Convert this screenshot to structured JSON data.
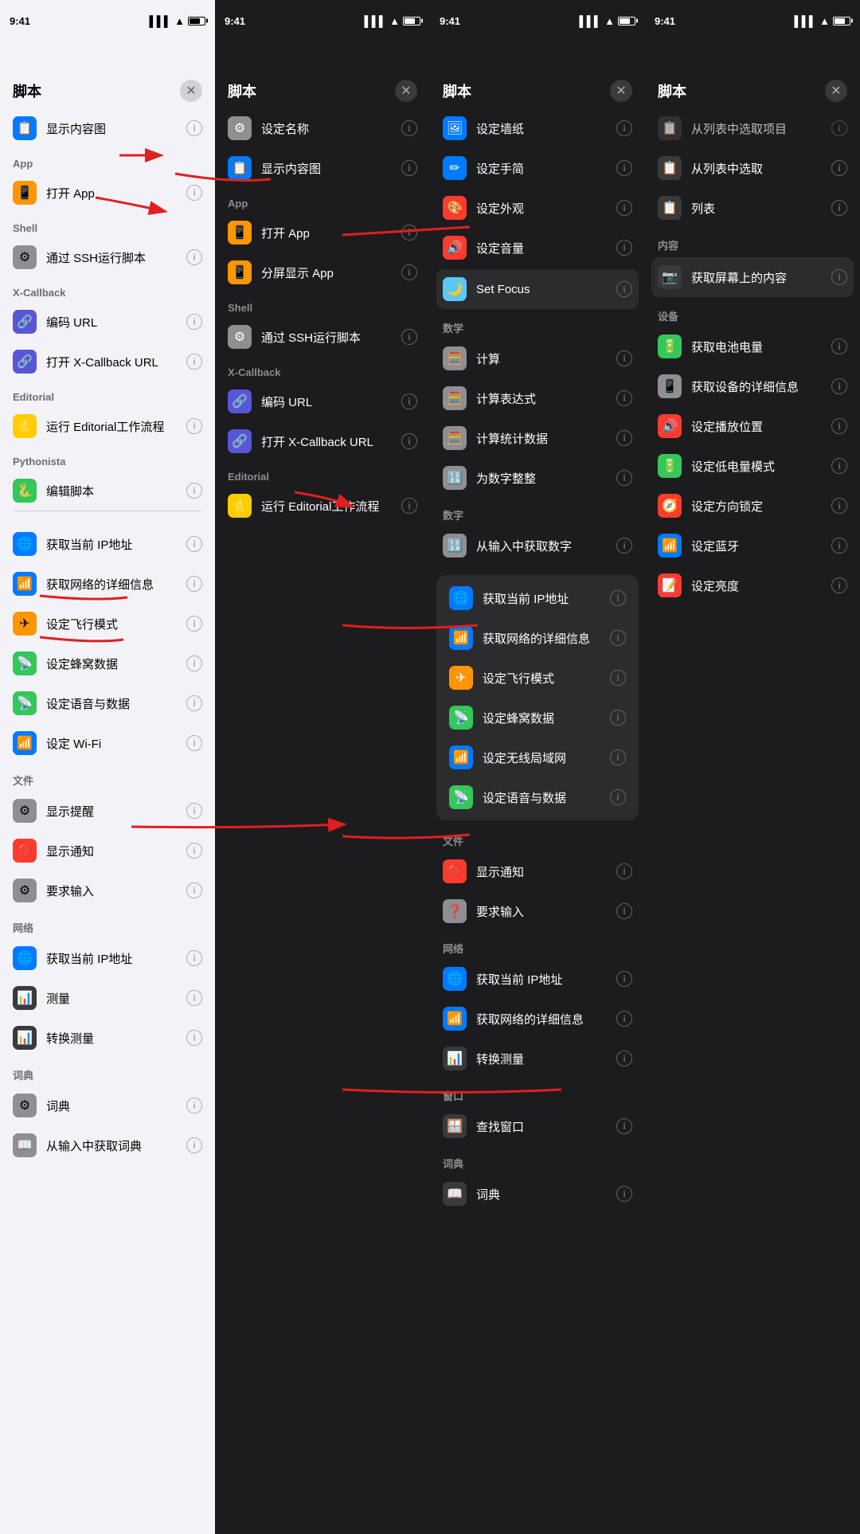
{
  "panels": [
    {
      "id": "panel1",
      "theme": "light",
      "status": {
        "time": "9:41"
      },
      "title": "脚本",
      "sections": [
        {
          "header": null,
          "items": [
            {
              "icon": "📋",
              "iconBg": "#007aff",
              "label": "显示内容图",
              "hasInfo": true
            }
          ]
        },
        {
          "header": "App",
          "items": [
            {
              "icon": "📱",
              "iconBg": "#ff9500",
              "label": "打开 App",
              "hasInfo": true
            }
          ]
        },
        {
          "header": "Shell",
          "items": [
            {
              "icon": "⚙️",
              "iconBg": "#8e8e93",
              "label": "通过 SSH运行脚本",
              "hasInfo": true
            }
          ]
        },
        {
          "header": "X-Callback",
          "items": [
            {
              "icon": "🔗",
              "iconBg": "#5856d6",
              "label": "编码 URL",
              "hasInfo": true
            },
            {
              "icon": "🔗",
              "iconBg": "#5856d6",
              "label": "打开 X-Callback URL",
              "hasInfo": true
            }
          ]
        },
        {
          "header": "Editorial",
          "items": [
            {
              "icon": "⭐",
              "iconBg": "#ffcc00",
              "label": "运行 Editorial工作流程",
              "hasInfo": true
            }
          ]
        },
        {
          "header": "Pythonista",
          "items": [
            {
              "icon": "🐍",
              "iconBg": "#34c759",
              "label": "编辑脚本",
              "hasInfo": true
            }
          ]
        }
      ],
      "networkSection": {
        "header": null,
        "items": [
          {
            "icon": "🌐",
            "iconBg": "#007aff",
            "label": "获取当前 IP地址",
            "hasInfo": true
          },
          {
            "icon": "📶",
            "iconBg": "#007aff",
            "label": "获取网络的详细信息",
            "hasInfo": true
          },
          {
            "icon": "✈️",
            "iconBg": "#ff9500",
            "label": "设定飞行模式",
            "hasInfo": true
          },
          {
            "icon": "📡",
            "iconBg": "#34c759",
            "label": "设定蜂窝数据",
            "hasInfo": true
          },
          {
            "icon": "📡",
            "iconBg": "#34c759",
            "label": "设定语音与数据",
            "hasInfo": true
          },
          {
            "icon": "📶",
            "iconBg": "#007aff",
            "label": "设定 Wi-Fi",
            "hasInfo": true
          }
        ]
      },
      "fileSection": {
        "header": "文件",
        "items": [
          {
            "icon": "⚙️",
            "iconBg": "#8e8e93",
            "label": "显示提醒",
            "hasInfo": true
          },
          {
            "icon": "🔴",
            "iconBg": "#ff3b30",
            "label": "显示通知",
            "hasInfo": true
          },
          {
            "icon": "⚙️",
            "iconBg": "#8e8e93",
            "label": "要求输入",
            "hasInfo": true
          }
        ]
      },
      "networkSection2": {
        "header": "网络",
        "items": [
          {
            "icon": "🌐",
            "iconBg": "#007aff",
            "label": "获取当前 IP地址",
            "hasInfo": true
          },
          {
            "icon": "📊",
            "iconBg": "#3a3a3c",
            "label": "测量",
            "hasInfo": true
          },
          {
            "icon": "📊",
            "iconBg": "#3a3a3c",
            "label": "转换测量",
            "hasInfo": true
          }
        ]
      },
      "dictSection": {
        "header": "词典",
        "items": [
          {
            "icon": "⚙️",
            "iconBg": "#8e8e93",
            "label": "词典",
            "hasInfo": true
          },
          {
            "icon": "📖",
            "iconBg": "#8e8e93",
            "label": "从输入中获取词典",
            "hasInfo": true
          }
        ]
      }
    },
    {
      "id": "panel2",
      "theme": "dark",
      "status": {
        "time": "9:41"
      },
      "title": "脚本",
      "topItems": [
        {
          "icon": "⚙️",
          "iconBg": "#8e8e93",
          "label": "设定名称",
          "hasInfo": true
        },
        {
          "icon": "📋",
          "iconBg": "#007aff",
          "label": "显示内容图",
          "hasInfo": true
        }
      ],
      "sections": [
        {
          "header": "App",
          "items": [
            {
              "icon": "📱",
              "iconBg": "#ff9500",
              "label": "打开 App",
              "hasInfo": true
            },
            {
              "icon": "📱",
              "iconBg": "#ff9500",
              "label": "分屏显示 App",
              "hasInfo": true
            }
          ]
        },
        {
          "header": "Shell",
          "items": [
            {
              "icon": "⚙️",
              "iconBg": "#8e8e93",
              "label": "通过 SSH运行脚本",
              "hasInfo": true
            }
          ]
        },
        {
          "header": "X-Callback",
          "items": [
            {
              "icon": "🔗",
              "iconBg": "#5856d6",
              "label": "编码 URL",
              "hasInfo": true
            },
            {
              "icon": "🔗",
              "iconBg": "#5856d6",
              "label": "打开 X-Callback URL",
              "hasInfo": true
            }
          ]
        },
        {
          "header": "Editorial",
          "items": [
            {
              "icon": "⭐",
              "iconBg": "#ffcc00",
              "label": "运行 Editorial工作流程",
              "hasInfo": true
            }
          ]
        }
      ]
    },
    {
      "id": "panel3",
      "theme": "dark",
      "status": {
        "time": "9:41"
      },
      "title": "脚本",
      "topItems": [
        {
          "icon": "🖼️",
          "iconBg": "#007aff",
          "label": "设定墙纸",
          "hasInfo": true
        },
        {
          "icon": "✏️",
          "iconBg": "#007aff",
          "label": "设定手简",
          "hasInfo": true
        },
        {
          "icon": "🎨",
          "iconBg": "#ff3b30",
          "label": "设定外观",
          "hasInfo": true
        },
        {
          "icon": "🔊",
          "iconBg": "#ff3b30",
          "label": "设定音量",
          "hasInfo": true
        },
        {
          "icon": "🌙",
          "iconBg": "#5ac8fa",
          "label": "Set Focus",
          "hasInfo": true,
          "highlighted": true
        }
      ],
      "sections": [
        {
          "header": "数学",
          "items": [
            {
              "icon": "🧮",
              "iconBg": "#8e8e93",
              "label": "计算",
              "hasInfo": true
            },
            {
              "icon": "🧮",
              "iconBg": "#8e8e93",
              "label": "计算表达式",
              "hasInfo": true
            },
            {
              "icon": "🧮",
              "iconBg": "#8e8e93",
              "label": "计算统计数据",
              "hasInfo": true
            },
            {
              "icon": "🔢",
              "iconBg": "#8e8e93",
              "label": "为数字整整",
              "hasInfo": true
            }
          ]
        },
        {
          "header": "数字",
          "items": [
            {
              "icon": "🔢",
              "iconBg": "#8e8e93",
              "label": "从输入中获取数字",
              "hasInfo": true
            }
          ]
        }
      ],
      "networkSection": {
        "header": null,
        "highlighted": true,
        "items": [
          {
            "icon": "🌐",
            "iconBg": "#007aff",
            "label": "获取当前 IP地址",
            "hasInfo": true
          },
          {
            "icon": "📶",
            "iconBg": "#007aff",
            "label": "获取网络的详细信息",
            "hasInfo": true
          },
          {
            "icon": "✈️",
            "iconBg": "#ff9500",
            "label": "设定飞行模式",
            "hasInfo": true
          },
          {
            "icon": "📡",
            "iconBg": "#34c759",
            "label": "设定蜂窝数据",
            "hasInfo": true
          },
          {
            "icon": "📶",
            "iconBg": "#007aff",
            "label": "设定无线局域网",
            "hasInfo": true
          },
          {
            "icon": "📡",
            "iconBg": "#34c759",
            "label": "设定语音与数据",
            "hasInfo": true
          }
        ]
      },
      "fileSection": {
        "header": "文件",
        "items": [
          {
            "icon": "🔴",
            "iconBg": "#ff3b30",
            "label": "显示通知",
            "hasInfo": true
          },
          {
            "icon": "❓",
            "iconBg": "#8e8e93",
            "label": "要求输入",
            "hasInfo": true
          }
        ]
      },
      "networkSection2": {
        "header": "网络",
        "items": [
          {
            "icon": "🌐",
            "iconBg": "#007aff",
            "label": "获取当前 IP地址",
            "hasInfo": true
          },
          {
            "icon": "📶",
            "iconBg": "#007aff",
            "label": "获取网络的详细信息",
            "hasInfo": true
          },
          {
            "icon": "📊",
            "iconBg": "#3a3a3c",
            "label": "转换测量",
            "hasInfo": true
          }
        ]
      },
      "windowSection": {
        "header": "窗口",
        "items": [
          {
            "icon": "🪟",
            "iconBg": "#3a3a3c",
            "label": "查找窗口",
            "hasInfo": true
          }
        ]
      },
      "dictSection": {
        "header": "词典",
        "items": [
          {
            "icon": "📖",
            "iconBg": "#3a3a3c",
            "label": "词典",
            "hasInfo": true
          }
        ]
      }
    },
    {
      "id": "panel4",
      "theme": "dark",
      "status": {
        "time": "9:41"
      },
      "title": "脚本",
      "topItems": [
        {
          "icon": "📋",
          "iconBg": "#3a3a3c",
          "label": "从列表中选取项目",
          "hasInfo": true
        },
        {
          "icon": "📋",
          "iconBg": "#3a3a3c",
          "label": "从列表中选取",
          "hasInfo": true
        },
        {
          "icon": "📋",
          "iconBg": "#3a3a3c",
          "label": "列表",
          "hasInfo": true
        }
      ],
      "contentSection": {
        "header": "内容",
        "items": [
          {
            "icon": "📷",
            "iconBg": "#3a3a3c",
            "label": "获取屏幕上的内容",
            "hasInfo": true,
            "highlighted": true
          }
        ]
      },
      "deviceSection": {
        "header": "设备",
        "items": [
          {
            "icon": "🔋",
            "iconBg": "#34c759",
            "label": "获取电池电量",
            "hasInfo": true
          },
          {
            "icon": "📱",
            "iconBg": "#8e8e93",
            "label": "获取设备的详细信息",
            "hasInfo": true
          },
          {
            "icon": "🔊",
            "iconBg": "#ff3b30",
            "label": "设定播放位置",
            "hasInfo": true
          },
          {
            "icon": "🔋",
            "iconBg": "#34c759",
            "label": "设定低电量模式",
            "hasInfo": true
          },
          {
            "icon": "🧭",
            "iconBg": "#ff3b30",
            "label": "设定方向锁定",
            "hasInfo": true
          },
          {
            "icon": "📶",
            "iconBg": "#007aff",
            "label": "设定蓝牙",
            "hasInfo": true
          },
          {
            "icon": "📝",
            "iconBg": "#ff3b30",
            "label": "设定亮度",
            "hasInfo": true
          }
        ]
      }
    }
  ]
}
